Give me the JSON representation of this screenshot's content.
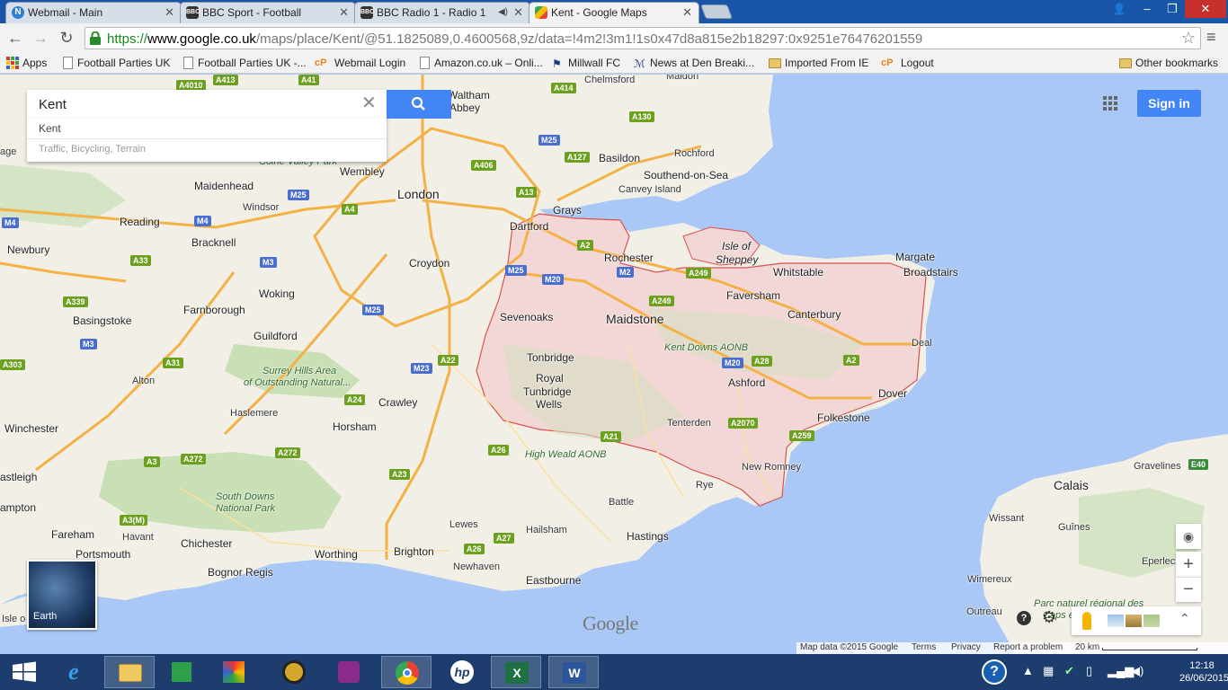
{
  "tabs": [
    {
      "title": "Webmail - Main",
      "favicon": "n-circle-icon"
    },
    {
      "title": "BBC Sport - Football",
      "favicon": "bbc-icon"
    },
    {
      "title": "BBC Radio 1 - Radio 1",
      "favicon": "bbc-icon"
    },
    {
      "title": "Kent - Google Maps",
      "favicon": "google-maps-icon"
    }
  ],
  "window_controls": {
    "minimize": "–",
    "maximize": "❐",
    "close": "✕"
  },
  "toolbar": {
    "url_scheme": "https://",
    "url_host": "www.google.co.uk",
    "url_path": "/maps/place/Kent/@51.1825089,0.4600568,9z/data=!4m2!3m1!1s0x47d8a815e2b18297:0x9251e76476201559"
  },
  "bookmarks": [
    {
      "label": "Apps",
      "icon": "apps-grid-icon"
    },
    {
      "label": "Football Parties UK",
      "icon": "page-icon"
    },
    {
      "label": "Football Parties UK -...",
      "icon": "page-icon"
    },
    {
      "label": "Webmail Login",
      "icon": "cpanel-icon"
    },
    {
      "label": "Amazon.co.uk – Onli...",
      "icon": "page-icon"
    },
    {
      "label": "Millwall FC",
      "icon": "millwall-icon"
    },
    {
      "label": "News at Den  Breaki...",
      "icon": "news-icon"
    },
    {
      "label": "Imported From IE",
      "icon": "folder-icon"
    },
    {
      "label": "Logout",
      "icon": "cpanel-icon"
    }
  ],
  "other_bookmarks": "Other bookmarks",
  "search": {
    "value": "Kent",
    "suggestion_1": "Kent",
    "suggestion_2": "Traffic, Bicycling, Terrain"
  },
  "sign_in": "Sign in",
  "earth_label": "Earth",
  "watermark": "Google",
  "zoom_in": "+",
  "zoom_out": "−",
  "map_footer": {
    "data": "Map data ©2015 Google",
    "terms": "Terms",
    "privacy": "Privacy",
    "report": "Report a problem",
    "scale": "20 km"
  },
  "places": {
    "london": "London",
    "dartford": "Dartford",
    "grays": "Grays",
    "basildon": "Basildon",
    "southend": "Southend-on-Sea",
    "canvey": "Canvey Island",
    "rochford": "Rochford",
    "chelmsford": "Chelmsford",
    "maldon": "Maldon",
    "waltham": "Waltham",
    "abbey": "Abbey",
    "wembley": "Wembley",
    "maidenhead": "Maidenhead",
    "windsor": "Windsor",
    "reading": "Reading",
    "bracknell": "Bracknell",
    "newbury": "Newbury",
    "croydon": "Croydon",
    "woking": "Woking",
    "farnborough": "Farnborough",
    "basingstoke": "Basingstoke",
    "guildford": "Guildford",
    "alton": "Alton",
    "haslemere": "Haslemere",
    "crawley": "Crawley",
    "horsham": "Horsham",
    "winchester": "Winchester",
    "eastleigh": "astleigh",
    "hampton": "ampton",
    "fareham": "Fareham",
    "havant": "Havant",
    "portsmouth": "Portsmouth",
    "chichester": "Chichester",
    "bognor": "Bognor Regis",
    "worthing": "Worthing",
    "brighton": "Brighton",
    "lewes": "Lewes",
    "newhaven": "Newhaven",
    "eastbourne": "Eastbourne",
    "hailsham": "Hailsham",
    "hastings": "Hastings",
    "battle": "Battle",
    "rye": "Rye",
    "newromney": "New Romney",
    "folkestone": "Folkestone",
    "dover": "Dover",
    "deal": "Deal",
    "ashford": "Ashford",
    "tenterden": "Tenterden",
    "canterbury": "Canterbury",
    "faversham": "Faversham",
    "whitstable": "Whitstable",
    "margate": "Margate",
    "broadstairs": "Broadstairs",
    "sheppey1": "Isle of",
    "sheppey2": "Sheppey",
    "rochester": "Rochester",
    "maidstone": "Maidstone",
    "sevenoaks": "Sevenoaks",
    "tonbridge": "Tonbridge",
    "royal": "Royal",
    "tunbridge": "Tunbridge",
    "wells": "Wells",
    "calais": "Calais",
    "gravelines": "Gravelines",
    "guines": "Guînes",
    "wissant": "Wissant",
    "wimereux": "Wimereux",
    "outreau": "Outreau",
    "eperlec": "Eperlec",
    "isle": "Isle o",
    "age": "age",
    "parc1": "Parc naturel régional des",
    "parc2": "Caps et",
    "kentdowns": "Kent Downs AONB",
    "highweald": "High Weald AONB",
    "surrey1": "Surrey Hills Area",
    "surrey2": "of Outstanding Natural...",
    "southdowns1": "South Downs",
    "southdowns2": "National Park",
    "colne": "Colne Valley Park"
  },
  "roads": {
    "a4010": "A4010",
    "a413": "A413",
    "a41": "A41",
    "a414": "A414",
    "a130": "A130",
    "m25a": "M25",
    "a127": "A127",
    "a406": "A406",
    "m25b": "M25",
    "a13": "A13",
    "a4": "A4",
    "m4a": "M4",
    "m4b": "M4",
    "a33": "A33",
    "m3a": "M3",
    "a339": "A339",
    "m3b": "M3",
    "m25c": "M25",
    "a2a": "A2",
    "m2": "M2",
    "a249a": "A249",
    "m25d": "M25",
    "m20a": "M20",
    "a249b": "A249",
    "m23": "M23",
    "a22": "A22",
    "a31": "A31",
    "a303": "A303",
    "a24": "A24",
    "m20b": "M20",
    "a28": "A28",
    "a2b": "A2",
    "a2070": "A2070",
    "a21": "A21",
    "a259": "A259",
    "a26a": "A26",
    "a272a": "A272",
    "a272b": "A272",
    "a23": "A23",
    "a3": "A3",
    "a3m": "A3(M)",
    "a27": "A27",
    "a26b": "A26",
    "e40": "E40"
  },
  "taskbar": {
    "time": "12:18",
    "date": "26/06/2015"
  },
  "colors": {
    "water": "#a9c8f5",
    "land": "#f2efe6",
    "forest": "#c9dfb5",
    "kent": "#f3d7d7",
    "border": "#d9534f"
  }
}
